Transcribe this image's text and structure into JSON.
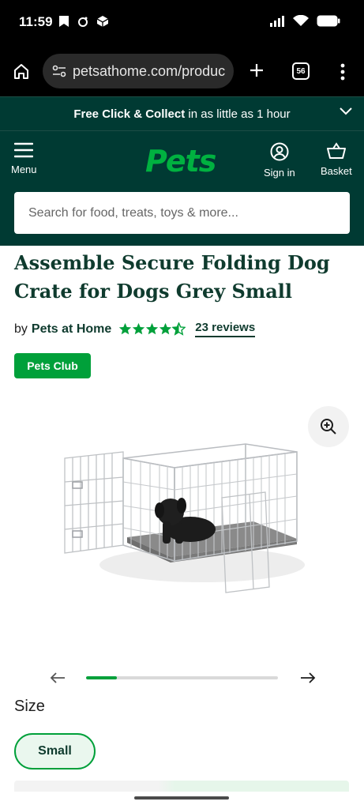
{
  "status_bar": {
    "time": "11:59",
    "icons": [
      "bookmark-icon",
      "circle-icon",
      "box-icon",
      "signal-icon",
      "wifi-icon",
      "battery-icon"
    ]
  },
  "browser": {
    "url": "petsathome.com/produc",
    "tab_count": "56",
    "icons": [
      "home-icon",
      "site-settings-icon",
      "plus-icon",
      "tab-switcher-icon",
      "more-vert-icon"
    ]
  },
  "promo": {
    "bold": "Free Click & Collect",
    "rest": " in as little as 1 hour"
  },
  "header": {
    "menu_label": "Menu",
    "logo": "Pets",
    "signin_label": "Sign in",
    "basket_label": "Basket",
    "search_placeholder": "Search for food, treats, toys & more..."
  },
  "product": {
    "title": "Assemble Secure Folding Dog Crate for Dogs Grey Small",
    "by": "by",
    "brand": "Pets at Home",
    "rating_stars": 4.5,
    "reviews": "23 reviews",
    "badge": "Pets Club",
    "image_alt": "Grey folding wire dog crate with a black puppy on a patterned cushion"
  },
  "carousel": {
    "progress": 0.16
  },
  "size": {
    "label": "Size",
    "selected": "Small"
  },
  "colors": {
    "brand_dark": "#003a33",
    "brand_green": "#00a03a",
    "title_color": "#0f3b2e"
  }
}
